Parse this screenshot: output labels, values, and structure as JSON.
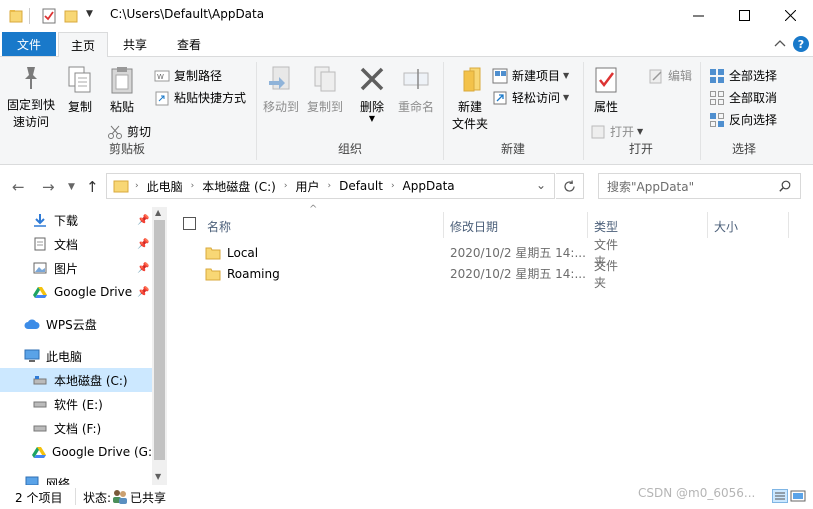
{
  "window": {
    "title": "C:\\Users\\Default\\AppData"
  },
  "tabs": {
    "file": "文件",
    "home": "主页",
    "share": "共享",
    "view": "查看"
  },
  "ribbon": {
    "clipboard": {
      "label": "剪贴板",
      "pin": "固定到快速访问",
      "pin_line1": "固定到快",
      "pin_line2": "速访问",
      "copy": "复制",
      "paste": "粘贴",
      "copy_path": "复制路径",
      "paste_shortcut": "粘贴快捷方式",
      "cut": "剪切"
    },
    "organize": {
      "label": "组织",
      "move_to": "移动到",
      "copy_to": "复制到",
      "delete": "删除",
      "rename": "重命名"
    },
    "new": {
      "label": "新建",
      "new_folder_line1": "新建",
      "new_folder_line2": "文件夹",
      "new_item": "新建项目",
      "easy_access": "轻松访问"
    },
    "open": {
      "label": "打开",
      "properties": "属性",
      "open": "打开",
      "edit": "编辑"
    },
    "select": {
      "label": "选择",
      "select_all": "全部选择",
      "select_none": "全部取消",
      "invert": "反向选择"
    }
  },
  "navbar": {
    "breadcrumb": [
      "此电脑",
      "本地磁盘 (C:)",
      "用户",
      "Default",
      "AppData"
    ],
    "search_placeholder": "搜索\"AppData\""
  },
  "sidebar": {
    "items": [
      {
        "label": "下载",
        "icon": "download-icon",
        "pinned": true
      },
      {
        "label": "文档",
        "icon": "document-icon",
        "pinned": true
      },
      {
        "label": "图片",
        "icon": "picture-icon",
        "pinned": true
      },
      {
        "label": "Google Drive",
        "icon": "google-drive-icon",
        "pinned": true
      },
      {
        "label": "WPS云盘",
        "icon": "cloud-icon",
        "pinned": false
      },
      {
        "label": "此电脑",
        "icon": "computer-icon",
        "pinned": false
      },
      {
        "label": "本地磁盘 (C:)",
        "icon": "drive-icon",
        "pinned": false,
        "selected": true
      },
      {
        "label": "软件 (E:)",
        "icon": "drive-icon",
        "pinned": false
      },
      {
        "label": "文档 (F:)",
        "icon": "drive-icon",
        "pinned": false
      },
      {
        "label": "Google Drive (G:",
        "icon": "google-drive-icon",
        "pinned": false
      },
      {
        "label": "网络",
        "icon": "network-icon",
        "pinned": false
      }
    ]
  },
  "table": {
    "columns": {
      "name": "名称",
      "date": "修改日期",
      "type": "类型",
      "size": "大小"
    },
    "rows": [
      {
        "name": "Local",
        "date": "2020/10/2 星期五 14:...",
        "type": "文件夹"
      },
      {
        "name": "Roaming",
        "date": "2020/10/2 星期五 14:...",
        "type": "文件夹"
      }
    ]
  },
  "status": {
    "count": "2 个项目",
    "state_label": "状态:",
    "state_value": "已共享"
  },
  "watermark": "CSDN @m0_6056...",
  "colors": {
    "accent": "#1979ca",
    "selected": "#cce8ff",
    "folder": "#f8d775"
  }
}
